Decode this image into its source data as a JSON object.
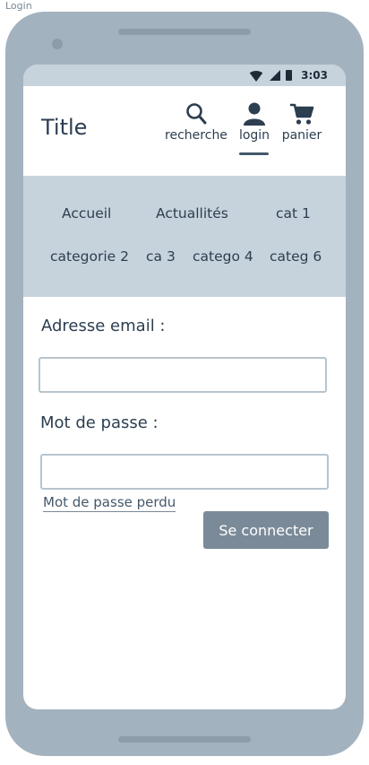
{
  "frame": {
    "label": "Login"
  },
  "status_bar": {
    "time": "3:03"
  },
  "header": {
    "title": "Title",
    "actions": [
      {
        "label": "recherche",
        "icon": "search-icon"
      },
      {
        "label": "login",
        "icon": "user-icon",
        "active": true
      },
      {
        "label": "panier",
        "icon": "cart-icon"
      }
    ]
  },
  "categories": [
    {
      "label": "Accueil"
    },
    {
      "label": "Actuallités"
    },
    {
      "label": "cat 1"
    },
    {
      "label": "categorie 2"
    },
    {
      "label": "ca 3"
    },
    {
      "label": "catego 4"
    },
    {
      "label": "categ 6"
    }
  ],
  "form": {
    "email_label": "Adresse email :",
    "email_value": "",
    "password_label": "Mot de passe :",
    "password_value": "",
    "forgot_link": "Mot de passe perdu",
    "submit_label": "Se connecter"
  },
  "colors": {
    "device": "#a3b2bf",
    "nav_background": "#c7d3dc",
    "text": "#2c3e50",
    "button": "#7b8a98"
  }
}
